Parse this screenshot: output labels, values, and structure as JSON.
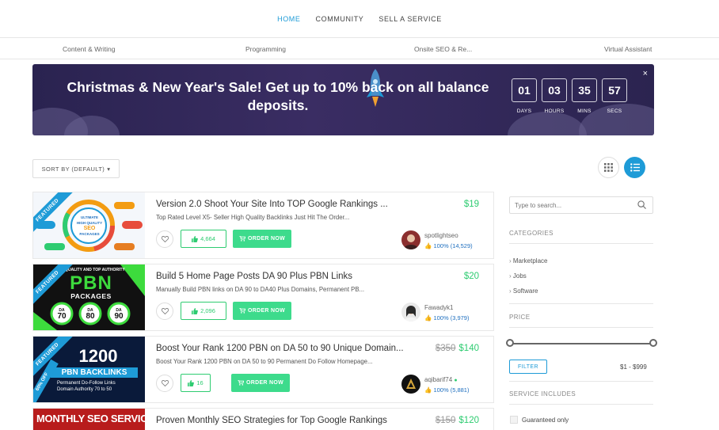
{
  "nav": {
    "items": [
      {
        "label": "HOME",
        "active": true
      },
      {
        "label": "COMMUNITY",
        "active": false
      },
      {
        "label": "SELL A SERVICE",
        "active": false
      }
    ]
  },
  "categories": [
    "Content & Writing",
    "Programming",
    "Onsite SEO & Re...",
    "Virtual Assistant"
  ],
  "banner": {
    "text": "Christmas & New Year's Sale! Get up to 10% back on all balance deposits.",
    "countdown": [
      {
        "value": "01",
        "label": "DAYS"
      },
      {
        "value": "03",
        "label": "HOURS"
      },
      {
        "value": "35",
        "label": "MINS"
      },
      {
        "value": "57",
        "label": "SECS"
      }
    ],
    "close_symbol": "×"
  },
  "sort": {
    "label": "SORT BY (DEFAULT)"
  },
  "listings": [
    {
      "title": "Version 2.0 Shoot Your Site Into TOP Google Rankings ...",
      "description": "Top Rated Level X5- Seller High Quality Backlinks Just Hit The Order...",
      "price_old": "",
      "price": "$19",
      "likes": "4,664",
      "order_label": "ORDER NOW",
      "seller": "spotlightseo",
      "rating": "100% (14,529)",
      "featured_label": "FEATURED",
      "thumb_lines": [
        "ULTIMATE",
        "HIGH QUALITY",
        "SEO",
        "PACKAGES"
      ]
    },
    {
      "title": "Build 5 Home Page Posts DA 90 Plus PBN Links",
      "description": "Manually Build PBN links on DA 90 to DA40 Plus Domains, Permanent PB...",
      "price_old": "",
      "price": "$20",
      "likes": "2,096",
      "order_label": "ORDER NOW",
      "seller": "Fawadyk1",
      "rating": "100% (3,979)",
      "featured_label": "FEATURED",
      "thumb_lines": [
        "QUALITY AND TOP AUTHORITY",
        "PBN",
        "PACKAGES",
        "DA",
        "70",
        "DA",
        "80",
        "DA",
        "90"
      ]
    },
    {
      "title": "Boost Your Rank 1200 PBN on DA 50 to 90 Unique Domain...",
      "description": "Boost Your Rank 1200 PBN on DA 50 to 90 Permanent Do Follow Homepage...",
      "price_old": "$350",
      "price": "$140",
      "likes": "16",
      "order_label": "ORDER NOW",
      "seller": "aqibarif74",
      "rating": "100% (5,881)",
      "featured_label": "FEATURED",
      "sale_label": "60% OFF",
      "thumb_lines": [
        "1200",
        "PBN BACKLINKS",
        "Permanent Do-Follow Links",
        "Domain Authority 70 to 50"
      ]
    },
    {
      "title": "Proven Monthly SEO Strategies for Top Google Rankings",
      "price_old": "$150",
      "price": "$120",
      "thumb_lines": [
        "MONTHLY SEO SERVICE"
      ]
    }
  ],
  "sidebar": {
    "search_placeholder": "Type to search...",
    "categories_heading": "CATEGORIES",
    "categories": [
      "Marketplace",
      "Jobs",
      "Software"
    ],
    "price_heading": "PRICE",
    "price_slider": {
      "min": 1,
      "max": 999,
      "low_fraction": 0.0,
      "high_fraction": 1.0
    },
    "filter_label": "FILTER",
    "range_text": "$1 - $999",
    "includes_heading": "SERVICE INCLUDES",
    "guaranteed_label": "Guaranteed only"
  },
  "colors": {
    "accent": "#1e9bd7",
    "green": "#2ecc71",
    "banner_bg": "#2f2757"
  }
}
